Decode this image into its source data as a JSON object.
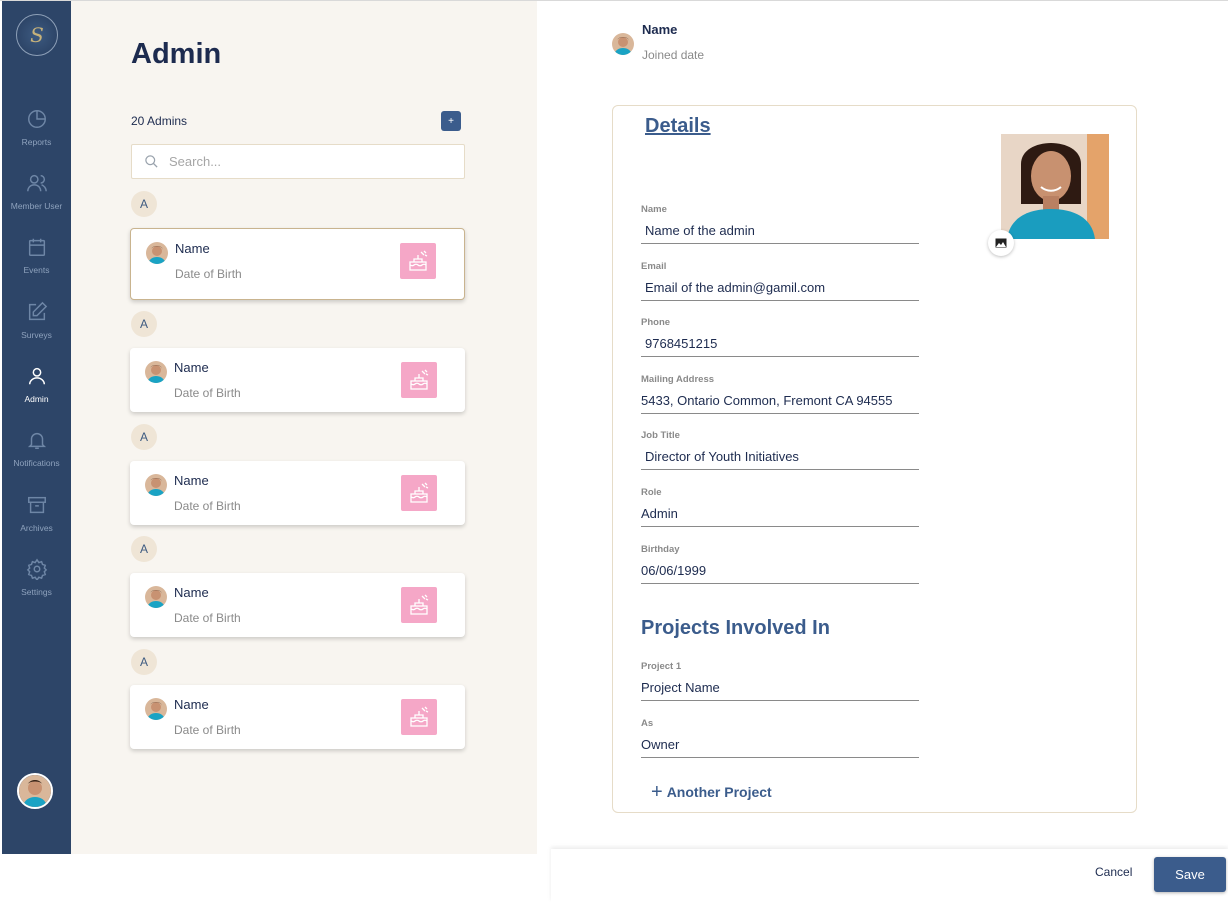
{
  "sidebar": {
    "items": [
      {
        "label": "Reports",
        "icon": "pie-chart-icon"
      },
      {
        "label": "Member User",
        "icon": "users-icon"
      },
      {
        "label": "Events",
        "icon": "calendar-icon"
      },
      {
        "label": "Surveys",
        "icon": "edit-icon"
      },
      {
        "label": "Admin",
        "icon": "user-icon",
        "active": true
      },
      {
        "label": "Notifications",
        "icon": "bell-icon"
      },
      {
        "label": "Archives",
        "icon": "archive-icon"
      },
      {
        "label": "Settings",
        "icon": "gear-icon"
      }
    ]
  },
  "list": {
    "title": "Admin",
    "count": "20 Admins",
    "search_placeholder": "Search...",
    "groups": [
      {
        "letter": "A",
        "name": "Name",
        "sub": "Date of Birth"
      },
      {
        "letter": "A",
        "name": "Name",
        "sub": "Date of Birth"
      },
      {
        "letter": "A",
        "name": "Name",
        "sub": "Date of Birth"
      },
      {
        "letter": "A",
        "name": "Name",
        "sub": "Date of Birth"
      },
      {
        "letter": "A",
        "name": "Name",
        "sub": "Date of Birth"
      }
    ]
  },
  "header": {
    "name": "Name",
    "joined": "Joined date"
  },
  "details": {
    "title": "Details",
    "fields": [
      {
        "label": "Name",
        "value": "Name of the admin"
      },
      {
        "label": "Email",
        "value": "Email of the admin@gamil.com"
      },
      {
        "label": "Phone",
        "value": "9768451215"
      },
      {
        "label": "Mailing Address",
        "value": "5433, Ontario Common, Fremont CA 94555"
      },
      {
        "label": "Job Title",
        "value": "Director of Youth Initiatives"
      },
      {
        "label": "Role",
        "value": "Admin"
      },
      {
        "label": "Birthday",
        "value": "06/06/1999"
      }
    ]
  },
  "projects": {
    "title": "Projects Involved In",
    "fields": [
      {
        "label": "Project 1",
        "value": "Project Name"
      },
      {
        "label": "As",
        "value": "Owner"
      }
    ],
    "another_label": "Another Project"
  },
  "footer": {
    "cancel_label": "Cancel",
    "save_label": "Save"
  },
  "colors": {
    "sidebar": "#2d4568",
    "accent": "#3b5c8c",
    "panel_bg": "#f8f5f0",
    "cake_bg": "#f5a7c7"
  }
}
